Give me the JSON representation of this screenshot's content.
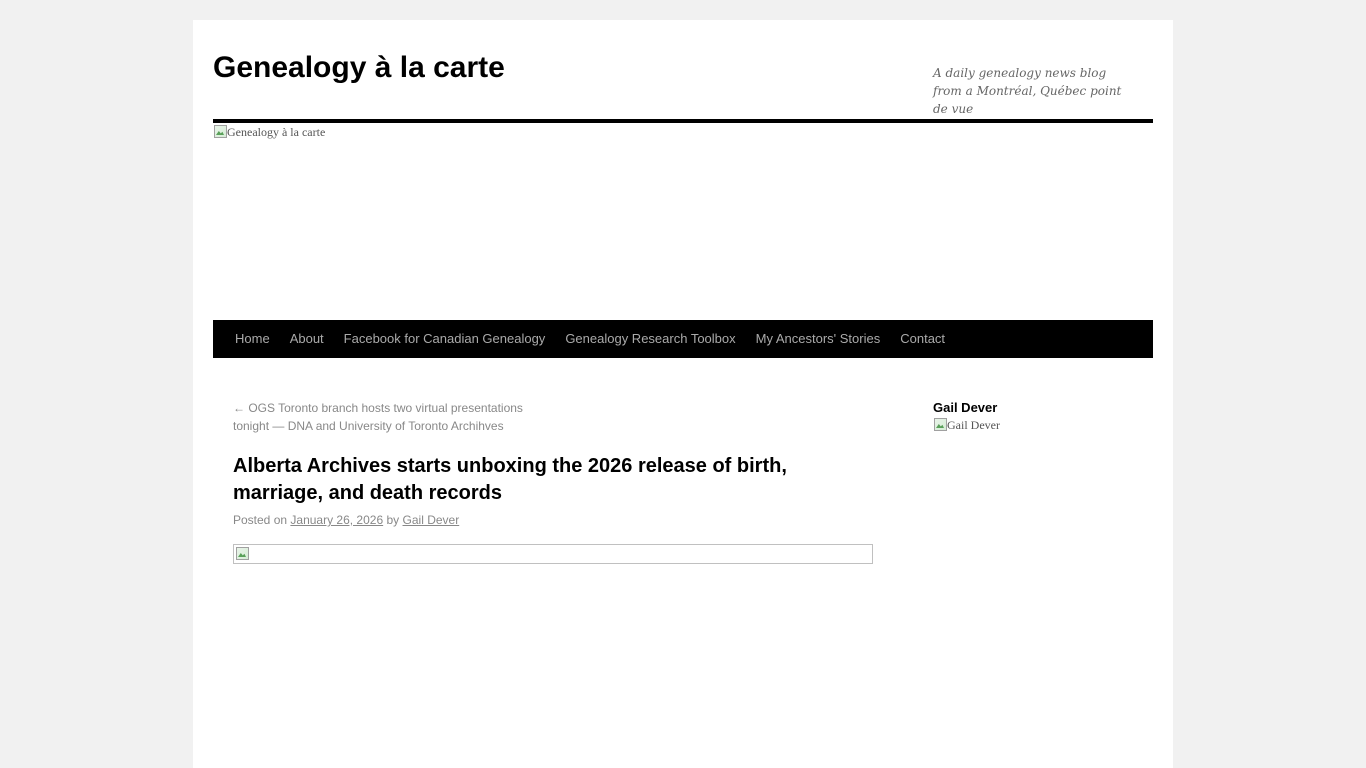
{
  "header": {
    "site_title": "Genealogy à la carte",
    "site_description": "A daily genealogy news blog from a Montréal, Québec point de vue",
    "header_image_alt": "Genealogy à la carte"
  },
  "nav": {
    "items": [
      {
        "label": "Home"
      },
      {
        "label": "About"
      },
      {
        "label": "Facebook for Canadian Genealogy"
      },
      {
        "label": "Genealogy Research Toolbox"
      },
      {
        "label": "My Ancestors' Stories"
      },
      {
        "label": "Contact"
      }
    ]
  },
  "post": {
    "previous_link": "← OGS Toronto branch hosts two virtual presentations tonight — DNA and University of Toronto Archihves",
    "title": "Alberta Archives starts unboxing the 2026 release of birth, marriage, and death records",
    "meta_posted_on": "Posted on",
    "meta_date": "January 26, 2026",
    "meta_by": "by",
    "meta_author": "Gail Dever"
  },
  "sidebar": {
    "widget_title": "Gail Dever",
    "widget_image_alt": "Gail Dever"
  },
  "colors": {
    "page_background": "#f1f1f1",
    "content_background": "#ffffff",
    "nav_background": "#000000",
    "nav_text": "#aaaaaa",
    "meta_text": "#888888"
  }
}
